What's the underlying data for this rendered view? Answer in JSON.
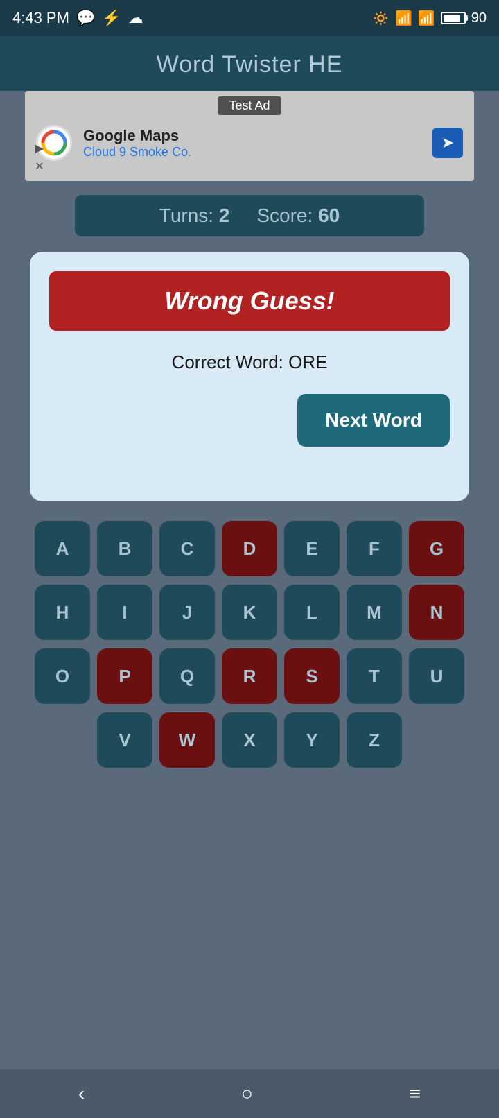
{
  "status_bar": {
    "time": "4:43 PM",
    "battery_percent": "90"
  },
  "app_header": {
    "title": "Word Twister HE"
  },
  "ad": {
    "label": "Test Ad",
    "company": "Google Maps",
    "subtitle": "Cloud 9 Smoke Co."
  },
  "score_bar": {
    "turns_label": "Turns:",
    "turns_value": "2",
    "score_label": "Score:",
    "score_value": "60"
  },
  "dialog": {
    "wrong_guess_text": "Wrong Guess!",
    "correct_word_label": "Correct Word: ORE",
    "next_word_button": "Next Word"
  },
  "keyboard": {
    "rows": [
      [
        "A",
        "B",
        "C",
        "D",
        "E",
        "F",
        "G"
      ],
      [
        "H",
        "I",
        "J",
        "K",
        "L",
        "M",
        "N"
      ],
      [
        "O",
        "P",
        "Q",
        "R",
        "S",
        "T",
        "U"
      ],
      [
        "V",
        "W",
        "X",
        "Y",
        "Z"
      ]
    ],
    "used_keys": [
      "D",
      "G",
      "N",
      "P",
      "R",
      "S",
      "W"
    ]
  },
  "nav_bar": {
    "back": "‹",
    "home": "○",
    "menu": "≡"
  }
}
